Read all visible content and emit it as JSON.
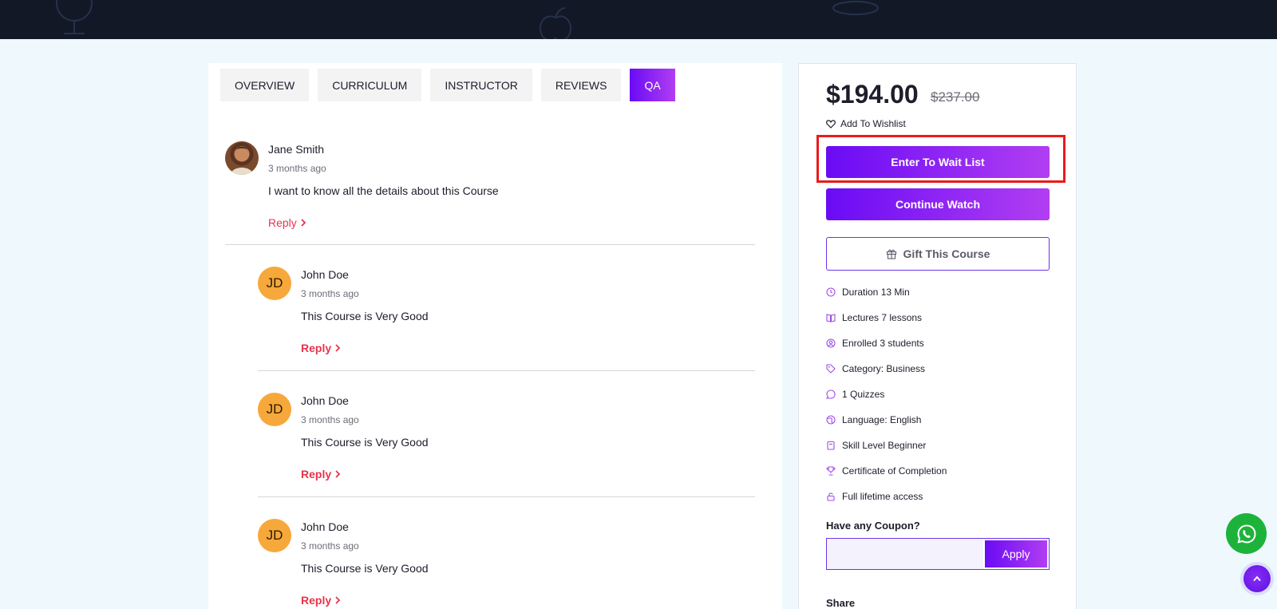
{
  "tabs": [
    {
      "label": "OVERVIEW"
    },
    {
      "label": "CURRICULUM"
    },
    {
      "label": "INSTRUCTOR"
    },
    {
      "label": "REVIEWS"
    },
    {
      "label": "QA"
    }
  ],
  "active_tab": "QA",
  "comments": [
    {
      "author": "Jane Smith",
      "time": "3 months ago",
      "text": "I want to know all the details about this Course",
      "reply_label": "Reply"
    },
    {
      "author": "John Doe",
      "initials": "JD",
      "time": "3 months ago",
      "text": "This Course is Very Good",
      "reply_label": "Reply"
    },
    {
      "author": "John Doe",
      "initials": "JD",
      "time": "3 months ago",
      "text": "This Course is Very Good",
      "reply_label": "Reply"
    },
    {
      "author": "John Doe",
      "initials": "JD",
      "time": "3 months ago",
      "text": "This Course is Very Good",
      "reply_label": "Reply"
    }
  ],
  "sidebar": {
    "price": "$194.00",
    "old_price": "$237.00",
    "wishlist_label": "Add To Wishlist",
    "wait_list_label": "Enter To Wait List",
    "continue_label": "Continue Watch",
    "gift_label": "Gift This Course",
    "features": [
      {
        "icon": "clock-icon",
        "label": "Duration 13 Min"
      },
      {
        "icon": "book-icon",
        "label": "Lectures 7 lessons"
      },
      {
        "icon": "user-icon",
        "label": "Enrolled 3 students"
      },
      {
        "icon": "tag-icon",
        "label": "Category: Business"
      },
      {
        "icon": "quiz-icon",
        "label": "1 Quizzes"
      },
      {
        "icon": "globe-icon",
        "label": "Language: English"
      },
      {
        "icon": "level-icon",
        "label": "Skill Level Beginner"
      },
      {
        "icon": "trophy-icon",
        "label": "Certificate of Completion"
      },
      {
        "icon": "lock-icon",
        "label": "Full lifetime access"
      }
    ],
    "coupon_label": "Have any Coupon?",
    "coupon_value": "",
    "apply_label": "Apply",
    "share_label": "Share"
  },
  "colors": {
    "accent_start": "#6a0bf5",
    "accent_end": "#b13ef2",
    "reply": "#e8344c",
    "highlight": "#ea1b1b",
    "whatsapp": "#1db33b"
  }
}
